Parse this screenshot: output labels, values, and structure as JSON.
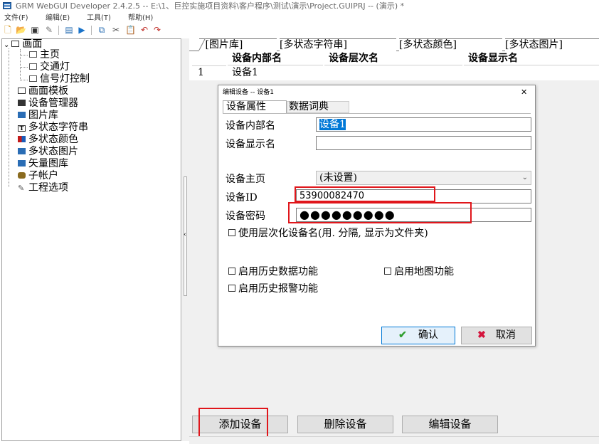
{
  "window": {
    "title": "GRM WebGUI Developer 2.4.2.5 -- E:\\1、巨控实施项目资料\\客户程序\\测试\\演示\\Project.GUIPRJ -- (演示) *"
  },
  "menu": [
    "文件(F)",
    "编辑(E)",
    "工具(T)",
    "帮助(H)"
  ],
  "toolbar": {
    "icons": [
      "new-file-icon",
      "open-folder-icon",
      "save-icon",
      "tool-wrench-icon",
      "image-icon",
      "run-icon",
      "copy-icon",
      "cut-icon",
      "paste-icon",
      "undo-icon",
      "redo-icon"
    ]
  },
  "tree": {
    "root": "画面",
    "pages": [
      "主页",
      "交通灯",
      "信号灯控制"
    ],
    "items": [
      "画面模板",
      "设备管理器",
      "图片库",
      "多状态字符串",
      "多状态颜色",
      "多状态图片",
      "矢量图库",
      "子帐户",
      "工程选项"
    ]
  },
  "tabs": [
    "[图片库]",
    "[多状态字符串]",
    "[多状态颜色]",
    "[多状态图片]"
  ],
  "grid": {
    "headers": [
      "设备内部名",
      "设备层次名",
      "设备显示名"
    ],
    "rows": [
      [
        "1",
        "设备1",
        "",
        ""
      ]
    ]
  },
  "buttons": {
    "add": "添加设备",
    "delete": "删除设备",
    "edit": "编辑设备"
  },
  "dialog": {
    "title": "编辑设备 -- 设备1",
    "close": "✕",
    "tabs": [
      "设备属性",
      "数据词典"
    ],
    "internal_name_label": "设备内部名",
    "internal_name_value": "设备1",
    "display_name_label": "设备显示名",
    "display_name_value": "",
    "homepage_label": "设备主页",
    "homepage_value": "(未设置)",
    "device_id_label": "设备ID",
    "device_id_value": "53900082470",
    "password_label": "设备密码",
    "password_value": "●●●●●●●●●",
    "hierarchical_label": "使用层次化设备名(用. 分隔, 显示为文件夹)",
    "history_data_label": "启用历史数据功能",
    "map_label": "启用地图功能",
    "history_alarm_label": "启用历史报警功能",
    "ok": "确认",
    "cancel": "取消"
  },
  "colors": {
    "highlight": "#e0161b",
    "selection": "#0078d7",
    "ok_icon": "#2e9e2e",
    "cancel_icon": "#d4143c"
  }
}
